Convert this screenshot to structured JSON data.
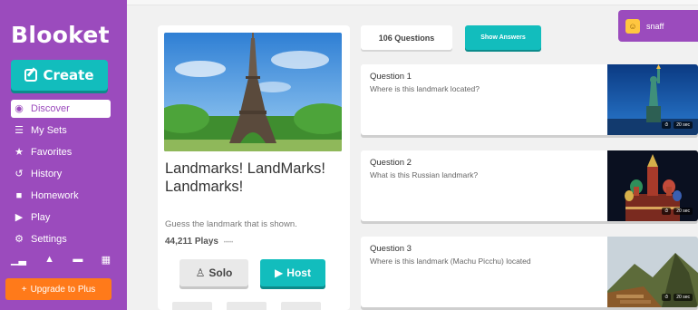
{
  "sidebar": {
    "logo": "Blooket",
    "create_label": "Create",
    "nav": [
      {
        "label": "Discover",
        "icon": "compass-icon",
        "active": true
      },
      {
        "label": "My Sets",
        "icon": "list-icon"
      },
      {
        "label": "Favorites",
        "icon": "star-icon"
      },
      {
        "label": "History",
        "icon": "history-icon"
      },
      {
        "label": "Homework",
        "icon": "document-icon"
      },
      {
        "label": "Play",
        "icon": "play-icon"
      },
      {
        "label": "Settings",
        "icon": "gear-icon"
      }
    ],
    "upgrade_label": "Upgrade to Plus"
  },
  "set": {
    "title": "Landmarks! LandMarks! Landmarks!",
    "description": "Guess the landmark that is shown.",
    "plays": "44,211 Plays",
    "solo_label": "Solo",
    "host_label": "Host"
  },
  "header": {
    "question_count": "106 Questions",
    "show_answers_label": "Show Answers",
    "username": "snaff"
  },
  "questions": [
    {
      "number": "Question 1",
      "text": "Where is this landmark located?",
      "time": "20 sec"
    },
    {
      "number": "Question 2",
      "text": "What is this Russian landmark?",
      "time": "20 sec"
    },
    {
      "number": "Question 3",
      "text": "Where is this landmark (Machu Picchu) located",
      "time": "20 sec"
    }
  ],
  "colors": {
    "sidebar": "#9b4bbd",
    "accent": "#12bdbd",
    "upgrade": "#ff7a1a",
    "background": "#f1f1f1"
  }
}
